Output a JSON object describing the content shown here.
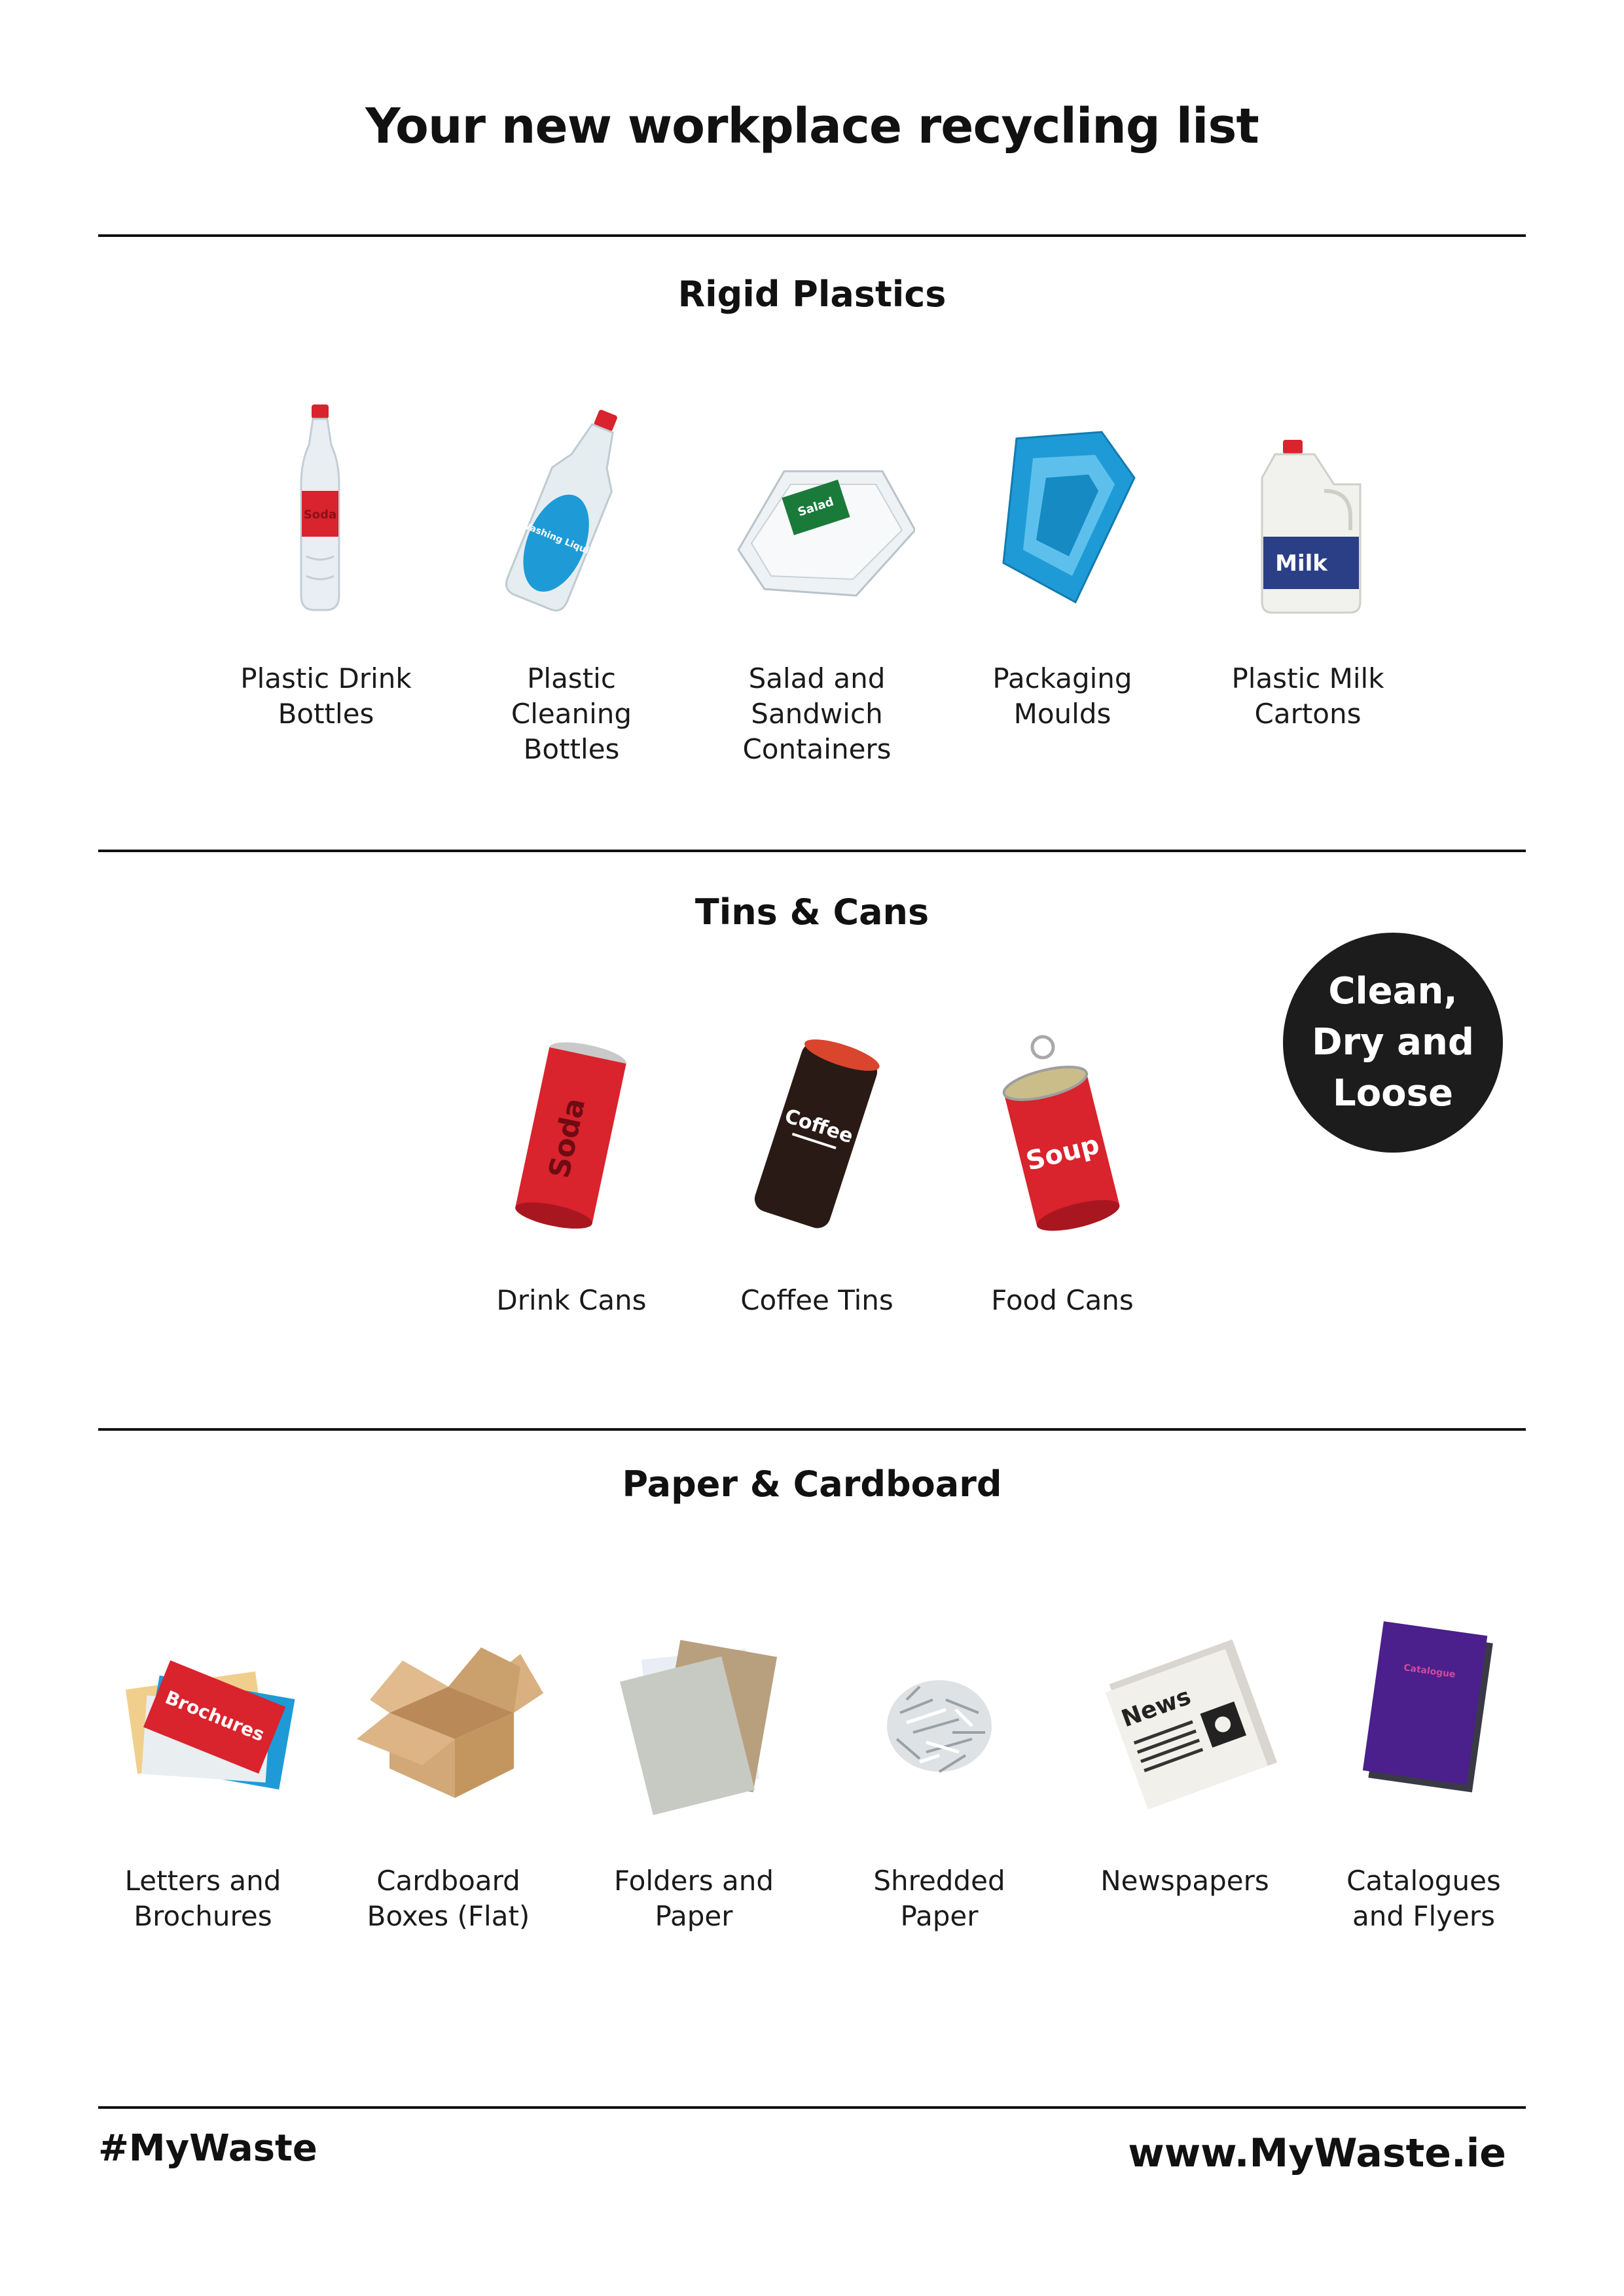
{
  "page": {
    "title": "Your new workplace recycling list"
  },
  "sections": [
    {
      "title": "Rigid Plastics",
      "items": [
        {
          "label_lines": [
            "Plastic Drink",
            "Bottles"
          ],
          "icon": "drink-bottle-icon",
          "image_text": "Soda"
        },
        {
          "label_lines": [
            "Plastic",
            "Cleaning",
            "Bottles"
          ],
          "icon": "cleaning-bottle-icon",
          "image_text": "Washing Liquid"
        },
        {
          "label_lines": [
            "Salad and",
            "Sandwich",
            "Containers"
          ],
          "icon": "salad-container-icon",
          "image_text": "Salad"
        },
        {
          "label_lines": [
            "Packaging",
            "Moulds"
          ],
          "icon": "packaging-mould-icon"
        },
        {
          "label_lines": [
            "Plastic Milk",
            "Cartons"
          ],
          "icon": "milk-carton-icon",
          "image_text": "Milk"
        }
      ]
    },
    {
      "title": "Tins & Cans",
      "items": [
        {
          "label_lines": [
            "Drink Cans"
          ],
          "icon": "drink-can-icon",
          "image_text": "Soda"
        },
        {
          "label_lines": [
            "Coffee Tins"
          ],
          "icon": "coffee-tin-icon",
          "image_text": "Coffee"
        },
        {
          "label_lines": [
            "Food Cans"
          ],
          "icon": "food-can-icon",
          "image_text": "Soup"
        }
      ]
    },
    {
      "title": "Paper & Cardboard",
      "items": [
        {
          "label_lines": [
            "Letters and",
            "Brochures"
          ],
          "icon": "brochures-icon",
          "image_text": "Brochures"
        },
        {
          "label_lines": [
            "Cardboard",
            "Boxes (Flat)"
          ],
          "icon": "cardboard-box-icon"
        },
        {
          "label_lines": [
            "Folders and",
            "Paper"
          ],
          "icon": "folders-icon"
        },
        {
          "label_lines": [
            "Shredded",
            "Paper"
          ],
          "icon": "shredded-paper-icon"
        },
        {
          "label_lines": [
            "Newspapers"
          ],
          "icon": "newspaper-icon",
          "image_text": "News"
        },
        {
          "label_lines": [
            "Catalogues",
            "and Flyers"
          ],
          "icon": "catalogue-icon",
          "image_text": "Catalogue"
        }
      ]
    }
  ],
  "badge": {
    "lines": [
      "Clean,",
      "Dry and",
      "Loose"
    ]
  },
  "footer": {
    "hashtag": "#MyWaste",
    "website": "www.MyWaste.ie"
  },
  "colors": {
    "text": "#111111",
    "badge_bg": "#1c1c1c",
    "accent_red": "#d9232d",
    "accent_blue": "#1e9bd7",
    "purple": "#4b1f8c"
  }
}
